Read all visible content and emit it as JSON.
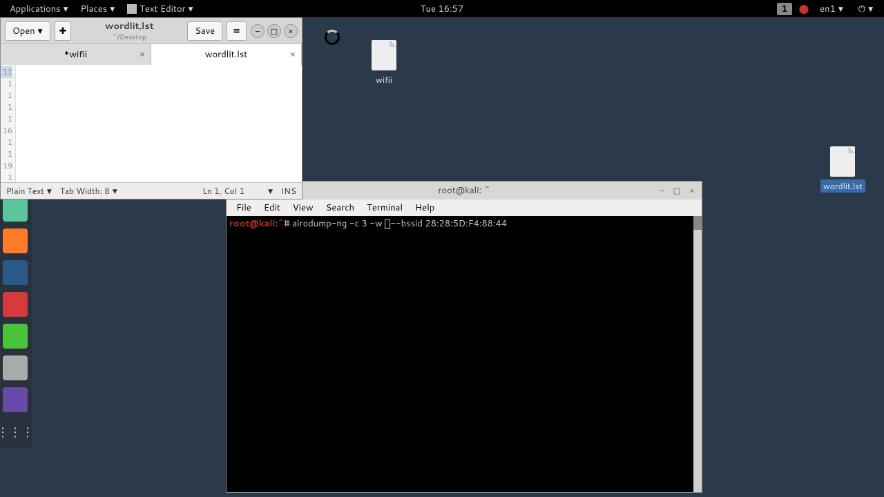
{
  "topbar": {
    "applications": "Applications",
    "places": "Places",
    "app": "Text Editor",
    "clock": "Tue 16:57",
    "workspace": "1",
    "lang": "en1"
  },
  "gedit": {
    "open": "Open",
    "save": "Save",
    "title": "wordlit.lst",
    "subtitle": "~/Desktop",
    "tabs": [
      "*wifii",
      "wordlit.lst"
    ],
    "gutter": [
      "11",
      "1",
      "1",
      "1",
      "1",
      "16",
      "1",
      "1",
      "19",
      "1"
    ],
    "status": {
      "lang": "Plain Text",
      "tabwidth": "Tab Width: 8",
      "pos": "Ln 1, Col 1",
      "mode": "INS"
    }
  },
  "desktop": {
    "file1": "wifii",
    "file2": "wordlit.lst"
  },
  "terminal": {
    "title": "root@kali: ~",
    "menu": [
      "File",
      "Edit",
      "View",
      "Search",
      "Terminal",
      "Help"
    ],
    "prompt_user": "root@kali",
    "prompt_path": "~",
    "command_pre": "airodump-ng -c 3 -w ",
    "command_post": "--bssid 28:28:5D:F4:88:44"
  }
}
